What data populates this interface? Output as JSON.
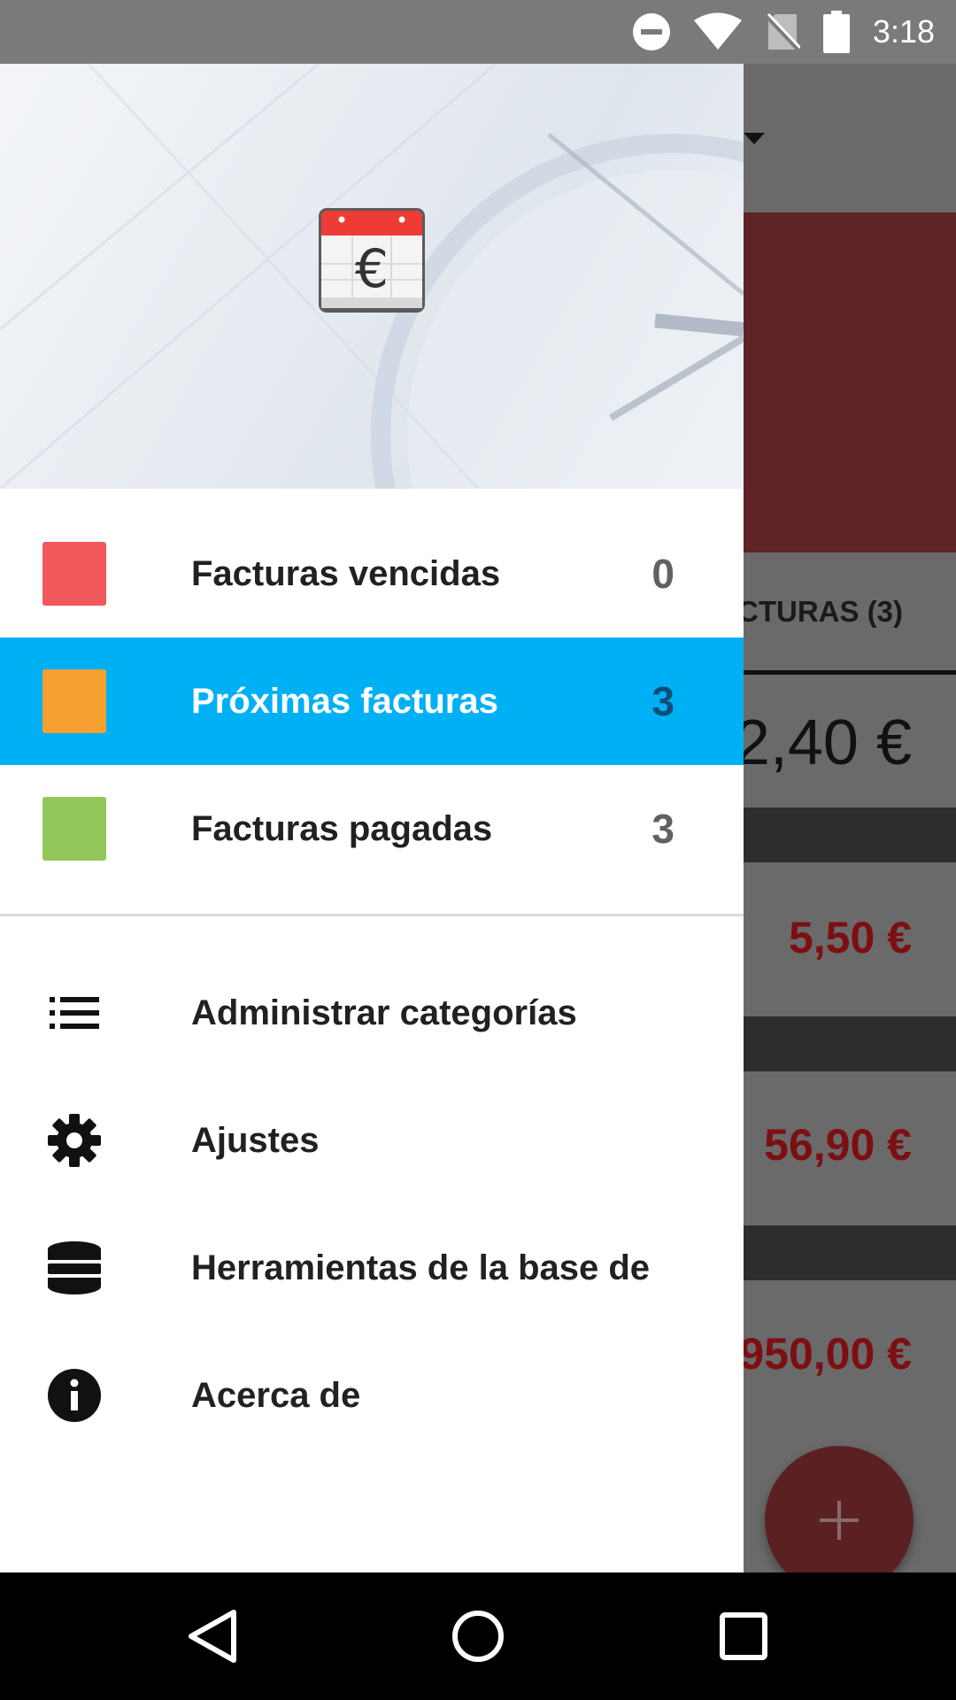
{
  "status_bar": {
    "time": "3:18",
    "icons": [
      "do-not-disturb-icon",
      "wifi-icon",
      "no-sim-icon",
      "battery-icon"
    ]
  },
  "background_app": {
    "tab_label": "CTURAS (3)",
    "total_amount": "2,40 €",
    "amounts": [
      "5,50 €",
      "56,90 €",
      "950,00 €"
    ],
    "fab_icon": "plus-icon"
  },
  "drawer": {
    "header_logo": "calendar-euro-icon",
    "logo_symbol": "€",
    "status_items": [
      {
        "label": "Facturas vencidas",
        "count": "0",
        "color": "#f2575b",
        "active": false
      },
      {
        "label": "Próximas facturas",
        "count": "3",
        "color": "#f6a031",
        "active": true
      },
      {
        "label": "Facturas pagadas",
        "count": "3",
        "color": "#93c658",
        "active": false
      }
    ],
    "menu_items": [
      {
        "label": "Administrar categorías",
        "icon": "list-icon"
      },
      {
        "label": "Ajustes",
        "icon": "gear-icon"
      },
      {
        "label": "Herramientas de la base de",
        "icon": "database-icon"
      },
      {
        "label": "Acerca de",
        "icon": "info-icon"
      }
    ],
    "active_color": "#00b0f5"
  },
  "nav_bar": {
    "buttons": [
      "back-icon",
      "home-icon",
      "recents-icon"
    ]
  }
}
